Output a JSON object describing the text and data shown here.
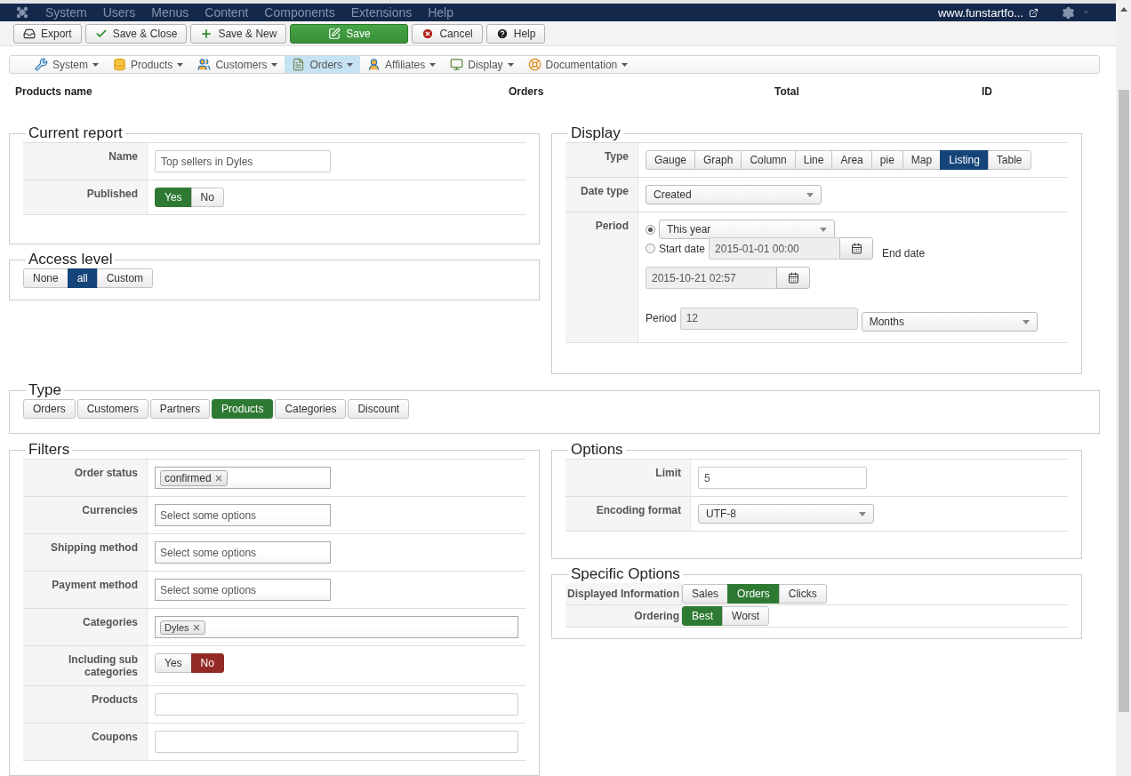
{
  "top_menu": {
    "items": [
      "System",
      "Users",
      "Menus",
      "Content",
      "Components",
      "Extensions",
      "Help"
    ],
    "site_link": "www.funstartfo..."
  },
  "toolbar": [
    {
      "label": "Export",
      "kind": "export"
    },
    {
      "label": "Save & Close",
      "kind": "save-close"
    },
    {
      "label": "Save & New",
      "kind": "save-new"
    },
    {
      "label": "Save",
      "kind": "save"
    },
    {
      "label": "Cancel",
      "kind": "cancel"
    },
    {
      "label": "Help",
      "kind": "help"
    }
  ],
  "submenu": [
    {
      "label": "System",
      "kind": "system",
      "selected": false
    },
    {
      "label": "Products",
      "kind": "products",
      "selected": false
    },
    {
      "label": "Customers",
      "kind": "customers",
      "selected": false
    },
    {
      "label": "Orders",
      "kind": "orders",
      "selected": true
    },
    {
      "label": "Affiliates",
      "kind": "affiliates",
      "selected": false
    },
    {
      "label": "Display",
      "kind": "display",
      "selected": false
    },
    {
      "label": "Documentation",
      "kind": "documentation",
      "selected": false
    }
  ],
  "listing_header": {
    "columns": [
      "Products name",
      "Orders",
      "Total",
      "ID"
    ]
  },
  "current_report": {
    "title": "Current report",
    "rows": [
      {
        "label": "Name",
        "kind": "text",
        "value": "Top sellers in Dyles"
      },
      {
        "label": "Published",
        "kind": "toggle",
        "options": [
          {
            "label": "Yes",
            "selected": true,
            "kind": "success"
          },
          {
            "label": "No",
            "selected": false,
            "kind": "danger"
          }
        ]
      }
    ]
  },
  "access_level": {
    "title": "Access level",
    "kind": "primary",
    "options": [
      {
        "label": "None",
        "selected": false
      },
      {
        "label": "all",
        "selected": true
      },
      {
        "label": "Custom",
        "selected": false
      }
    ]
  },
  "display": {
    "title": "Display",
    "type": {
      "label": "Type",
      "kind": "primary",
      "options": [
        {
          "label": "Gauge",
          "selected": false
        },
        {
          "label": "Graph",
          "selected": false
        },
        {
          "label": "Column",
          "selected": false
        },
        {
          "label": "Line",
          "selected": false
        },
        {
          "label": "Area",
          "selected": false
        },
        {
          "label": "pie",
          "selected": false
        },
        {
          "label": "Map",
          "selected": false
        },
        {
          "label": "Listing",
          "selected": true
        },
        {
          "label": "Table",
          "selected": false
        }
      ]
    },
    "date_type": {
      "label": "Date type",
      "value": "Created"
    },
    "period": {
      "label": "Period",
      "preset": {
        "selected": true,
        "value": "This year"
      },
      "range": {
        "selected": false,
        "label": "Start date",
        "start": "2015-01-01 00:00",
        "end_label": "End date",
        "end": "2015-10-21 02:57"
      },
      "count": {
        "label": "Period",
        "value": "12",
        "unit": "Months"
      }
    }
  },
  "type": {
    "title": "Type",
    "kind": "success",
    "options": [
      {
        "label": "Orders",
        "selected": false
      },
      {
        "label": "Customers",
        "selected": false
      },
      {
        "label": "Partners",
        "selected": false
      },
      {
        "label": "Products",
        "selected": true
      },
      {
        "label": "Categories",
        "selected": false
      },
      {
        "label": "Discount",
        "selected": false
      }
    ]
  },
  "filters": {
    "title": "Filters",
    "rows": [
      {
        "label": "Order status",
        "kind": "tags",
        "tags": [
          "confirmed"
        ]
      },
      {
        "label": "Currencies",
        "kind": "multiselect",
        "placeholder": "Select some options"
      },
      {
        "label": "Shipping method",
        "kind": "multiselect",
        "placeholder": "Select some options"
      },
      {
        "label": "Payment method",
        "kind": "multiselect",
        "placeholder": "Select some options"
      },
      {
        "label": "Categories",
        "kind": "tags-wide",
        "tags": [
          "Dyles"
        ]
      },
      {
        "label": "Including sub categories",
        "kind": "toggle",
        "options": [
          {
            "label": "Yes",
            "selected": false,
            "kind": "success"
          },
          {
            "label": "No",
            "selected": true,
            "kind": "danger"
          }
        ]
      },
      {
        "label": "Products",
        "kind": "wide-text"
      },
      {
        "label": "Coupons",
        "kind": "wide-text"
      }
    ]
  },
  "options": {
    "title": "Options",
    "rows": [
      {
        "label": "Limit",
        "kind": "text",
        "value": "5"
      },
      {
        "label": "Encoding format",
        "kind": "select",
        "value": "UTF-8"
      }
    ]
  },
  "specific_options": {
    "title": "Specific Options",
    "kind": "success",
    "rows": [
      {
        "label": "Displayed Information",
        "options": [
          {
            "label": "Sales",
            "selected": false
          },
          {
            "label": "Orders",
            "selected": true
          },
          {
            "label": "Clicks",
            "selected": false
          }
        ]
      },
      {
        "label": "Ordering",
        "options": [
          {
            "label": "Best",
            "selected": true
          },
          {
            "label": "Worst",
            "selected": false
          }
        ]
      }
    ]
  }
}
